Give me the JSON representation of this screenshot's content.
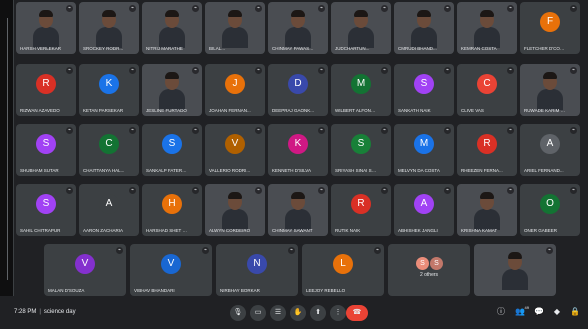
{
  "meeting": {
    "time": "7:28 PM",
    "separator": "|",
    "title": "science day",
    "others_label": "2 others",
    "participant_count": "49"
  },
  "rows": [
    [
      {
        "name": "HARSH VERLEKAR",
        "video": true
      },
      {
        "name": "SROCKEY RODR...",
        "video": true
      },
      {
        "name": "Nitrij Marathe",
        "video": true
      },
      {
        "name": "BILAL...",
        "video": true
      },
      {
        "name": "Chinmay Pawaskar",
        "video": true
      },
      {
        "name": "JUDCHARTUN...",
        "video": true
      },
      {
        "name": "CMRUDI BHAND...",
        "video": true
      },
      {
        "name": "KEMRAN COSTA",
        "video": true
      },
      {
        "name": "FLETCHER D'COS...",
        "video": false,
        "initial": "F",
        "color": "#e8710a"
      }
    ],
    [
      {
        "name": "RIZWAN AZAVEDO",
        "video": false,
        "initial": "R",
        "color": "#d93025"
      },
      {
        "name": "KETAN PARSEKAR",
        "video": false,
        "initial": "K",
        "color": "#1a73e8"
      },
      {
        "name": "JESLINE FURTADO",
        "video": true
      },
      {
        "name": "JOAHAN FERNAN...",
        "video": false,
        "initial": "J",
        "color": "#e8710a"
      },
      {
        "name": "DEEPRAJ GAONK...",
        "video": false,
        "initial": "D",
        "color": "#3949ab"
      },
      {
        "name": "WILBERT ALFONSO",
        "video": false,
        "initial": "M",
        "color": "#137333"
      },
      {
        "name": "SANKATH NAIK",
        "video": false,
        "initial": "S",
        "color": "#a142f4"
      },
      {
        "name": "CLIVE VAS",
        "video": false,
        "initial": "C",
        "color": "#ea4335"
      },
      {
        "name": "Ruwade Karim K...",
        "video": true
      }
    ],
    [
      {
        "name": "SHUBHAM SUTAR",
        "video": false,
        "initial": "S",
        "color": "#a142f4"
      },
      {
        "name": "CHAITTANYA HAL...",
        "video": false,
        "initial": "C",
        "color": "#137333"
      },
      {
        "name": "SANKALP FATERP...",
        "video": false,
        "initial": "S",
        "color": "#1a73e8"
      },
      {
        "name": "VALLERIO RODRI...",
        "video": false,
        "initial": "V",
        "color": "#b06000"
      },
      {
        "name": "KENNETH D'SILVA",
        "video": false,
        "initial": "K",
        "color": "#d01884"
      },
      {
        "name": "SRIYASH SINAI SA...",
        "video": false,
        "initial": "S",
        "color": "#188038"
      },
      {
        "name": "MELVYN DA COSTA",
        "video": false,
        "initial": "M",
        "color": "#1a73e8"
      },
      {
        "name": "RHEEZEN FERNA...",
        "video": false,
        "initial": "R",
        "color": "#d93025"
      },
      {
        "name": "ARIEL FERNAND...",
        "video": false,
        "initial": "A",
        "color": "#5f6368"
      }
    ],
    [
      {
        "name": "SAHIL CHITRAPUR",
        "video": false,
        "initial": "S",
        "color": "#a142f4"
      },
      {
        "name": "AARON ZACHARIA",
        "video": false,
        "initial": "A",
        "color": "#3c4043"
      },
      {
        "name": "HARSHAD SHET D...",
        "video": false,
        "initial": "H",
        "color": "#e8710a"
      },
      {
        "name": "ALWYN CORDEIRO",
        "video": true
      },
      {
        "name": "CHINMAY SAWANT",
        "video": true
      },
      {
        "name": "RUTIK NAIK",
        "video": false,
        "initial": "R",
        "color": "#d93025"
      },
      {
        "name": "ABHISHEK JANGLI",
        "video": false,
        "initial": "A",
        "color": "#a142f4"
      },
      {
        "name": "KRISHNA KAMAT",
        "video": true
      },
      {
        "name": "ONER GABEER",
        "video": false,
        "initial": "O",
        "color": "#137333"
      }
    ],
    [
      {
        "name": "MALAN D'SOUZA",
        "video": false,
        "initial": "V",
        "color": "#8430ce"
      },
      {
        "name": "VIBHAV BHANDARI",
        "video": false,
        "initial": "V",
        "color": "#1967d2"
      },
      {
        "name": "NIRBHAY BORKAR",
        "video": false,
        "initial": "N",
        "color": "#3949ab"
      },
      {
        "name": "LEEJOY REBELLO",
        "video": false,
        "initial": "L",
        "color": "#e8710a"
      },
      {
        "name": "others",
        "video": false,
        "others": true,
        "initials": [
          "S",
          "S"
        ],
        "colors": [
          "#ea8d7a",
          "#c2786a"
        ]
      },
      {
        "name": "",
        "video": true
      }
    ]
  ],
  "controls": {
    "mic_icon": "mic-icon",
    "cam_icon": "camera-icon",
    "cc_icon": "captions-icon",
    "hand_icon": "raise-hand-icon",
    "present_icon": "present-icon",
    "more_icon": "more-icon",
    "end_icon": "end-call-icon",
    "info_icon": "info-icon",
    "people_icon": "people-icon",
    "chat_icon": "chat-icon",
    "shapes_icon": "activities-icon",
    "lock_icon": "host-controls-icon"
  }
}
